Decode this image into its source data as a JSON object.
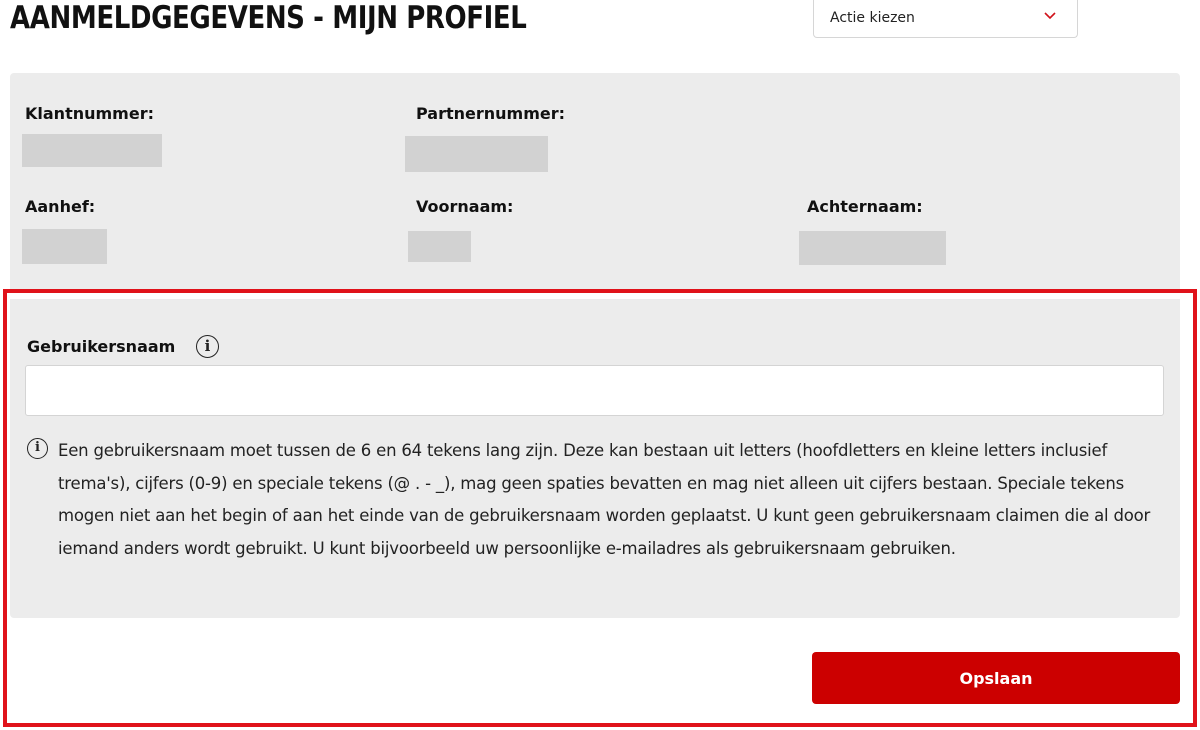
{
  "header": {
    "title": "AANMELDGEGEVENS - MIJN PROFIEL"
  },
  "action_select": {
    "selected_label": "Actie kiezen",
    "icon": "chevron-down-icon"
  },
  "profile": {
    "customer_number_label": "Klantnummer:",
    "partner_number_label": "Partnernummer:",
    "salutation_label": "Aanhef:",
    "first_name_label": "Voornaam:",
    "last_name_label": "Achternaam:",
    "values_masked": true
  },
  "username_section": {
    "label": "Gebruikersnaam",
    "info_icon": "info-icon",
    "input_value": "",
    "input_placeholder": "",
    "help_icon": "info-icon",
    "help_text": "Een gebruikersnaam moet tussen de 6 en 64 tekens lang zijn. Deze kan bestaan uit letters (hoofdletters en kleine letters inclusief trema's), cijfers (0-9) en speciale tekens (@ . - _), mag geen spaties bevatten en mag niet alleen uit cijfers bestaan. Speciale tekens mogen niet aan het begin of aan het einde van de gebruikersnaam worden geplaatst. U kunt geen gebruikersnaam claimen die al door iemand anders wordt gebruikt. U kunt bijvoorbeeld uw persoonlijke e-mailadres als gebruikersnaam gebruiken."
  },
  "actions": {
    "save_label": "Opslaan"
  },
  "colors": {
    "accent_red": "#cc0000",
    "highlight_frame": "#e0121a",
    "panel_background": "#ececec",
    "masked_field": "#d2d2d2"
  }
}
